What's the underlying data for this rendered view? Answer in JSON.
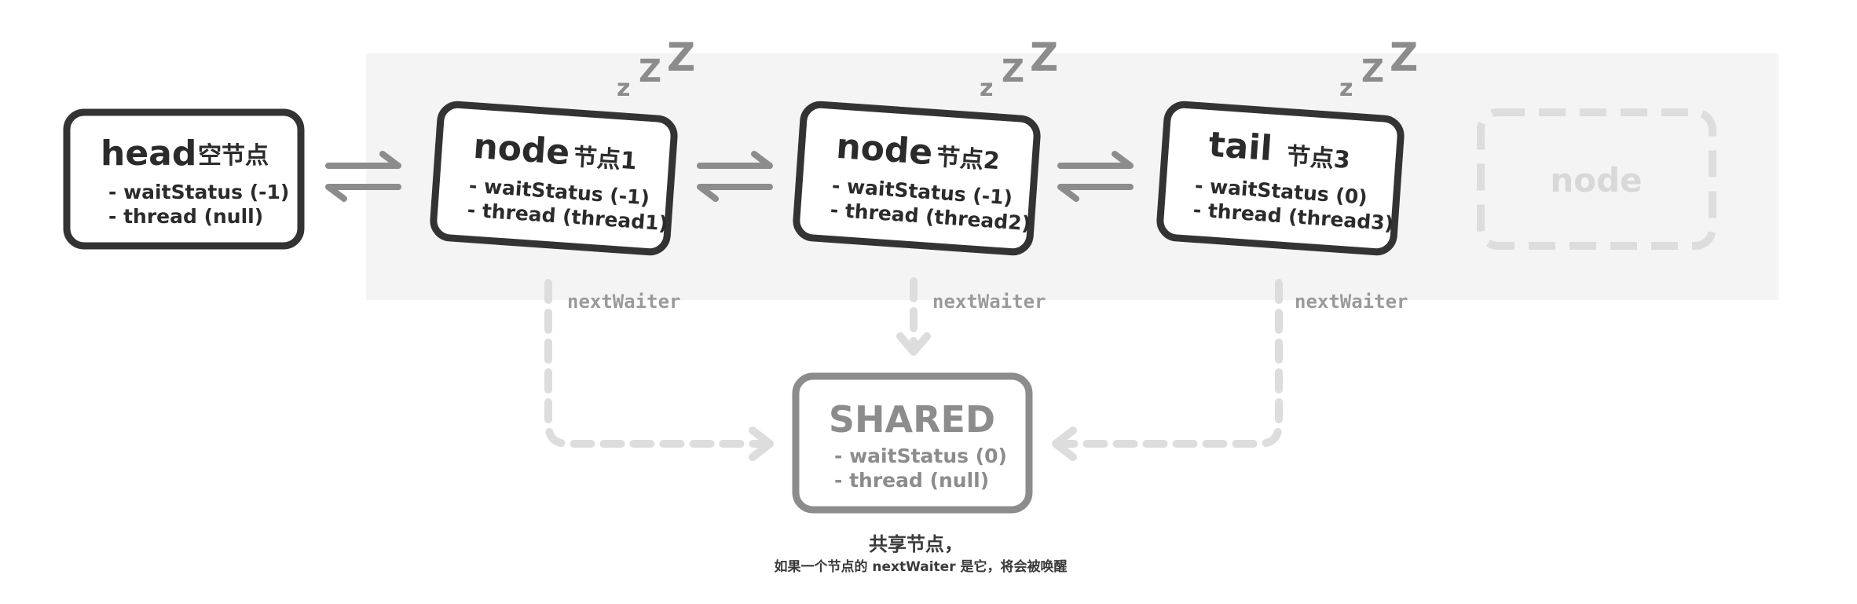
{
  "diagram": {
    "nodes": {
      "head": {
        "title": "head",
        "subtitle": "空节点",
        "wait_status": "- waitStatus (-1)",
        "thread": "- thread (null)"
      },
      "node1": {
        "title": "node",
        "subtitle": "节点1",
        "wait_status": "- waitStatus (-1)",
        "thread": "- thread (thread1)",
        "sleep": "z Z Z"
      },
      "node2": {
        "title": "node",
        "subtitle": "节点2",
        "wait_status": "- waitStatus (-1)",
        "thread": "- thread (thread2)",
        "sleep": "z Z Z"
      },
      "tail": {
        "title": "tail",
        "subtitle": "节点3",
        "wait_status": "- waitStatus (0)",
        "thread": "- thread (thread3)",
        "sleep": "z Z Z"
      },
      "ghost": {
        "title": "node"
      },
      "shared": {
        "title": "SHARED",
        "wait_status": "- waitStatus (0)",
        "thread": "- thread (null)"
      }
    },
    "edge_labels": {
      "left": "nextWaiter",
      "middle": "nextWaiter",
      "right": "nextWaiter"
    },
    "caption": {
      "title": "共享节点，",
      "note": "如果一个节点的 nextWaiter 是它，将会被唤醒"
    },
    "colors": {
      "node_border": "#333333",
      "shared_border": "#8c8c8c",
      "ghost_border": "#dddddd",
      "queue_background": "#f4f4f4",
      "arrow": "#8c8c8c",
      "dashed_link": "#dddddd"
    }
  }
}
